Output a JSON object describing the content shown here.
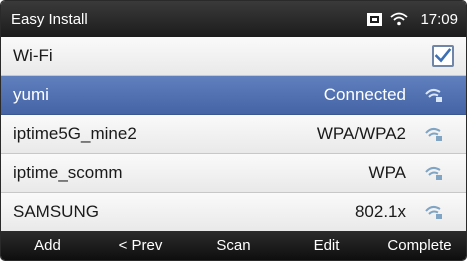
{
  "statusbar": {
    "title": "Easy Install",
    "time": "17:09",
    "icons": [
      "sim-card-icon",
      "wifi-status-icon"
    ]
  },
  "wifi_toggle": {
    "label": "Wi-Fi",
    "checked": true
  },
  "networks": [
    {
      "name": "yumi",
      "status": "Connected",
      "selected": true
    },
    {
      "name": "iptime5G_mine2",
      "status": "WPA/WPA2",
      "selected": false
    },
    {
      "name": "iptime_scomm",
      "status": "WPA",
      "selected": false
    },
    {
      "name": "SAMSUNG",
      "status": "802.1x",
      "selected": false
    }
  ],
  "toolbar": {
    "add": "Add",
    "prev": "< Prev",
    "scan": "Scan",
    "edit": "Edit",
    "complete": "Complete"
  },
  "colors": {
    "selected_row": "#4f6eb0",
    "accent_check": "#3d6fb5",
    "wifi_icon": "#7fa4c4"
  }
}
